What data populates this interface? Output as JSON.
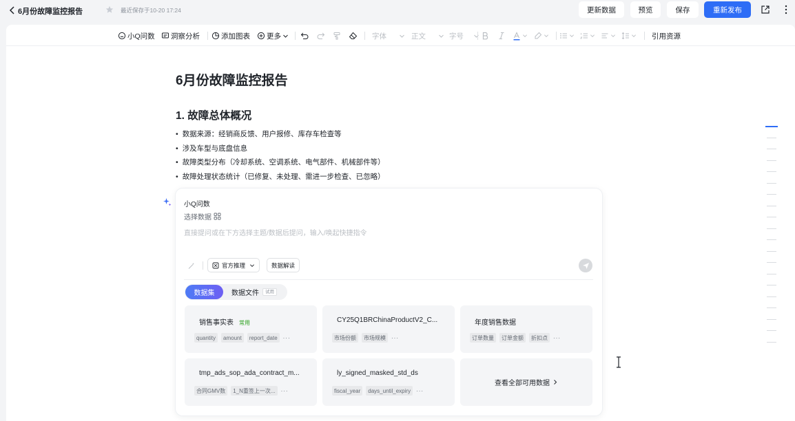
{
  "header": {
    "title": "6月份故障监控报告",
    "saved_text": "最近保存于10-20 17:24",
    "buttons": {
      "update_data": "更新数据",
      "preview": "预览",
      "save": "保存",
      "republish": "重新发布"
    }
  },
  "toolbar": {
    "ask": "小Q问数",
    "insight": "洞察分析",
    "add_chart": "添加图表",
    "more": "更多",
    "font": "字体",
    "body_text": "正文",
    "font_size": "字号",
    "cite": "引用资源"
  },
  "document": {
    "h1": "6月份故障监控报告",
    "h2": "1. 故障总体概况",
    "bullets": [
      "数据来源：经销商反馈、用户报修、库存车检查等",
      "涉及车型与底盘信息",
      "故障类型分布（冷却系统、空调系统、电气部件、机械部件等）",
      "故障处理状态统计（已修复、未处理、需进一步检查、已忽略）"
    ]
  },
  "ask_panel": {
    "title": "小Q问数",
    "select_data": "选择数据",
    "placeholder": "直接提问或在下方选择主题/数据后提问，输入/唤起快捷指令",
    "chip_official": "官方推理",
    "chip_interpret": "数据解读",
    "tabs": {
      "dataset": "数据集",
      "datafile": "数据文件",
      "trial": "试用"
    },
    "datasets": [
      {
        "name": "销售事实表",
        "badge": "常用",
        "tags": [
          "quantity",
          "amount",
          "report_date"
        ]
      },
      {
        "name": "CY25Q1BRChinaProductV2_C...",
        "badge": "",
        "tags": [
          "市场份额",
          "市场规模"
        ]
      },
      {
        "name": "年度销售数据",
        "badge": "",
        "tags": [
          "订单数量",
          "订单金额",
          "折扣点"
        ]
      },
      {
        "name": "tmp_ads_sop_ada_contract_m...",
        "badge": "",
        "tags": [
          "合同GMV数",
          "1_N重签上一次..."
        ]
      },
      {
        "name": "ly_signed_masked_std_ds",
        "badge": "",
        "tags": [
          "fiscal_year",
          "days_until_expiry"
        ]
      }
    ],
    "view_all": "查看全部可用数据",
    "more_dots": "···"
  },
  "colors": {
    "primary": "#2e6df6",
    "badge_green": "#2ea121"
  }
}
